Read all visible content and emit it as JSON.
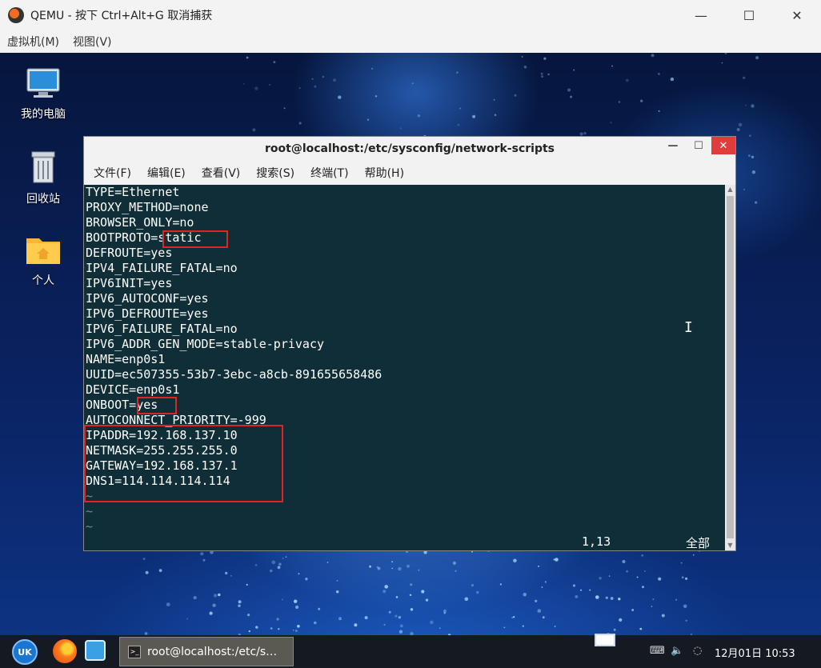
{
  "host": {
    "title": "QEMU - 按下 Ctrl+Alt+G 取消捕获",
    "menu": [
      "虚拟机(M)",
      "视图(V)"
    ],
    "controls": {
      "minimize": "—",
      "maximize": "☐",
      "close": "✕"
    }
  },
  "desktop": {
    "icons": [
      {
        "label": "我的电脑",
        "icon": "computer-icon"
      },
      {
        "label": "回收站",
        "icon": "trash-icon"
      },
      {
        "label": "个人",
        "icon": "home-folder-icon"
      }
    ]
  },
  "terminal": {
    "title": "root@localhost:/etc/sysconfig/network-scripts",
    "menu": [
      "文件(F)",
      "编辑(E)",
      "查看(V)",
      "搜索(S)",
      "终端(T)",
      "帮助(H)"
    ],
    "lines": [
      "TYPE=Ethernet",
      "PROXY_METHOD=none",
      "BROWSER_ONLY=no",
      "BOOTPROTO=static",
      "DEFROUTE=yes",
      "IPV4_FAILURE_FATAL=no",
      "IPV6INIT=yes",
      "IPV6_AUTOCONF=yes",
      "IPV6_DEFROUTE=yes",
      "IPV6_FAILURE_FATAL=no",
      "IPV6_ADDR_GEN_MODE=stable-privacy",
      "NAME=enp0s1",
      "UUID=ec507355-53b7-3ebc-a8cb-891655658486",
      "DEVICE=enp0s1",
      "ONBOOT=yes",
      "AUTOCONNECT_PRIORITY=-999",
      "IPADDR=192.168.137.10",
      "NETMASK=255.255.255.0",
      "GATEWAY=192.168.137.1",
      "DNS1=114.114.114.114"
    ],
    "tildes": [
      "~",
      "~",
      "~"
    ],
    "status": {
      "position": "1,13",
      "view": "全部"
    }
  },
  "taskbar": {
    "start_label": "UK",
    "task_label": "root@localhost:/etc/s…",
    "clock": "12月01日 10:53"
  }
}
